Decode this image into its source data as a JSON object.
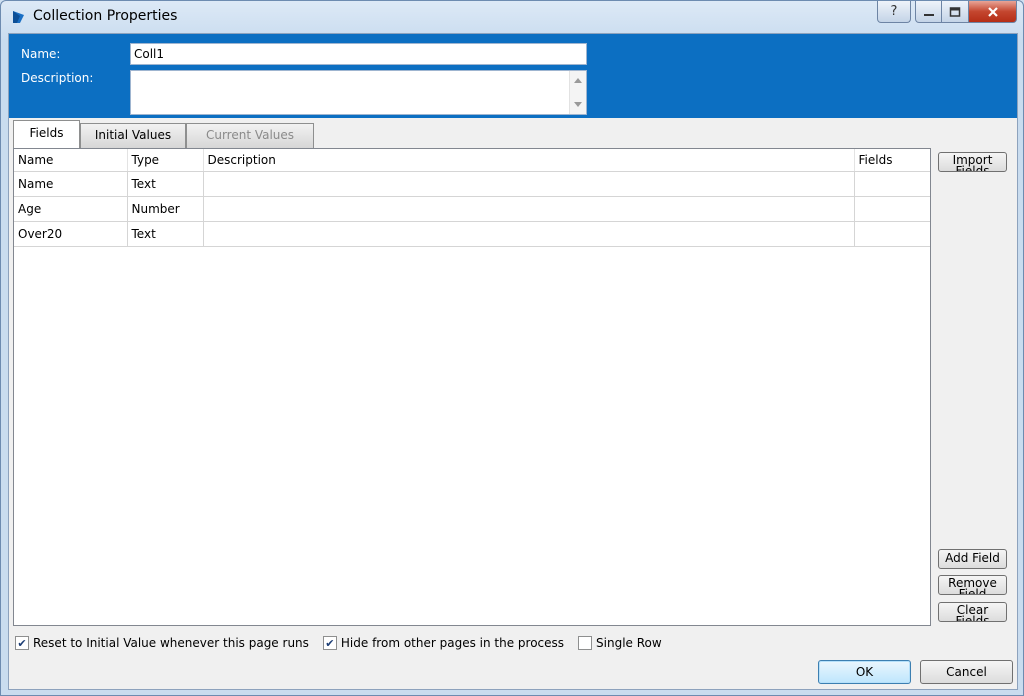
{
  "window": {
    "title": "Collection Properties",
    "help_label": "?",
    "min_label": "—",
    "max_label": "▢",
    "close_label": "✕"
  },
  "form": {
    "name_label": "Name:",
    "name_value": "Coll1",
    "description_label": "Description:",
    "description_value": ""
  },
  "tabs": [
    {
      "label": "Fields",
      "active": true
    },
    {
      "label": "Initial Values",
      "active": false
    },
    {
      "label": "Current Values",
      "active": false,
      "disabled": true
    }
  ],
  "grid": {
    "columns": [
      "Name",
      "Type",
      "Description",
      "Fields"
    ],
    "rows": [
      {
        "name": "Name",
        "type": "Text",
        "description": "",
        "fields": ""
      },
      {
        "name": "Age",
        "type": "Number",
        "description": "",
        "fields": ""
      },
      {
        "name": "Over20",
        "type": "Text",
        "description": "",
        "fields": ""
      }
    ]
  },
  "side_buttons": {
    "import_fields": "Import Fields",
    "add_field": "Add Field",
    "remove_field": "Remove Field",
    "clear_fields": "Clear Fields"
  },
  "options": {
    "reset_initial": {
      "label": "Reset to Initial Value whenever this page runs",
      "checked": true
    },
    "hide_other_pages": {
      "label": "Hide from other pages in the process",
      "checked": true
    },
    "single_row": {
      "label": "Single Row",
      "checked": false
    }
  },
  "buttons": {
    "ok": "OK",
    "cancel": "Cancel"
  },
  "colors": {
    "header_blue": "#0c6fc2",
    "icon_blue": "#1a6fc4"
  }
}
